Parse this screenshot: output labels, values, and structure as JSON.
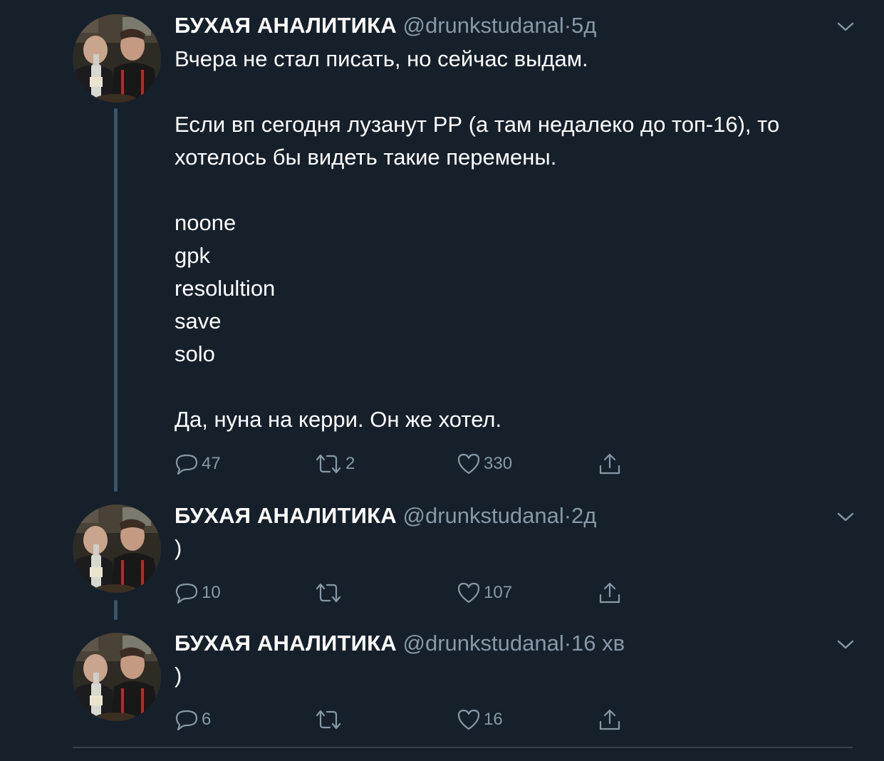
{
  "tweets": [
    {
      "name": "БУХАЯ АНАЛИТИКА",
      "handle": "@drunkstudanal",
      "separator": "·",
      "time": "5д",
      "lines": [
        "Вчера не стал писать, но сейчас выдам.",
        "",
        "Если вп сегодня лузанут РР (а там недалеко до топ-16), то",
        "хотелось бы видеть такие перемены.",
        "",
        "noone",
        "gpk",
        "resolultion",
        "save",
        "solo",
        "",
        "Да, нуна на керри. Он же хотел."
      ],
      "replies": "47",
      "retweets": "2",
      "likes": "330"
    },
    {
      "name": "БУХАЯ АНАЛИТИКА",
      "handle": "@drunkstudanal",
      "separator": "·",
      "time": "2д",
      "lines": [
        ")"
      ],
      "replies": "10",
      "retweets": "",
      "likes": "107"
    },
    {
      "name": "БУХАЯ АНАЛИТИКА",
      "handle": "@drunkstudanal",
      "separator": "·",
      "time": "16 хв",
      "lines": [
        ")"
      ],
      "replies": "6",
      "retweets": "",
      "likes": "16"
    }
  ],
  "icons": {
    "reply": "reply-icon",
    "retweet": "retweet-icon",
    "like": "heart-icon",
    "share": "share-icon",
    "menu": "chevron-down-icon"
  },
  "colors": {
    "background": "#15202b",
    "text": "#ffffff",
    "secondary": "#8899a6",
    "thread_line": "#3d5466"
  }
}
